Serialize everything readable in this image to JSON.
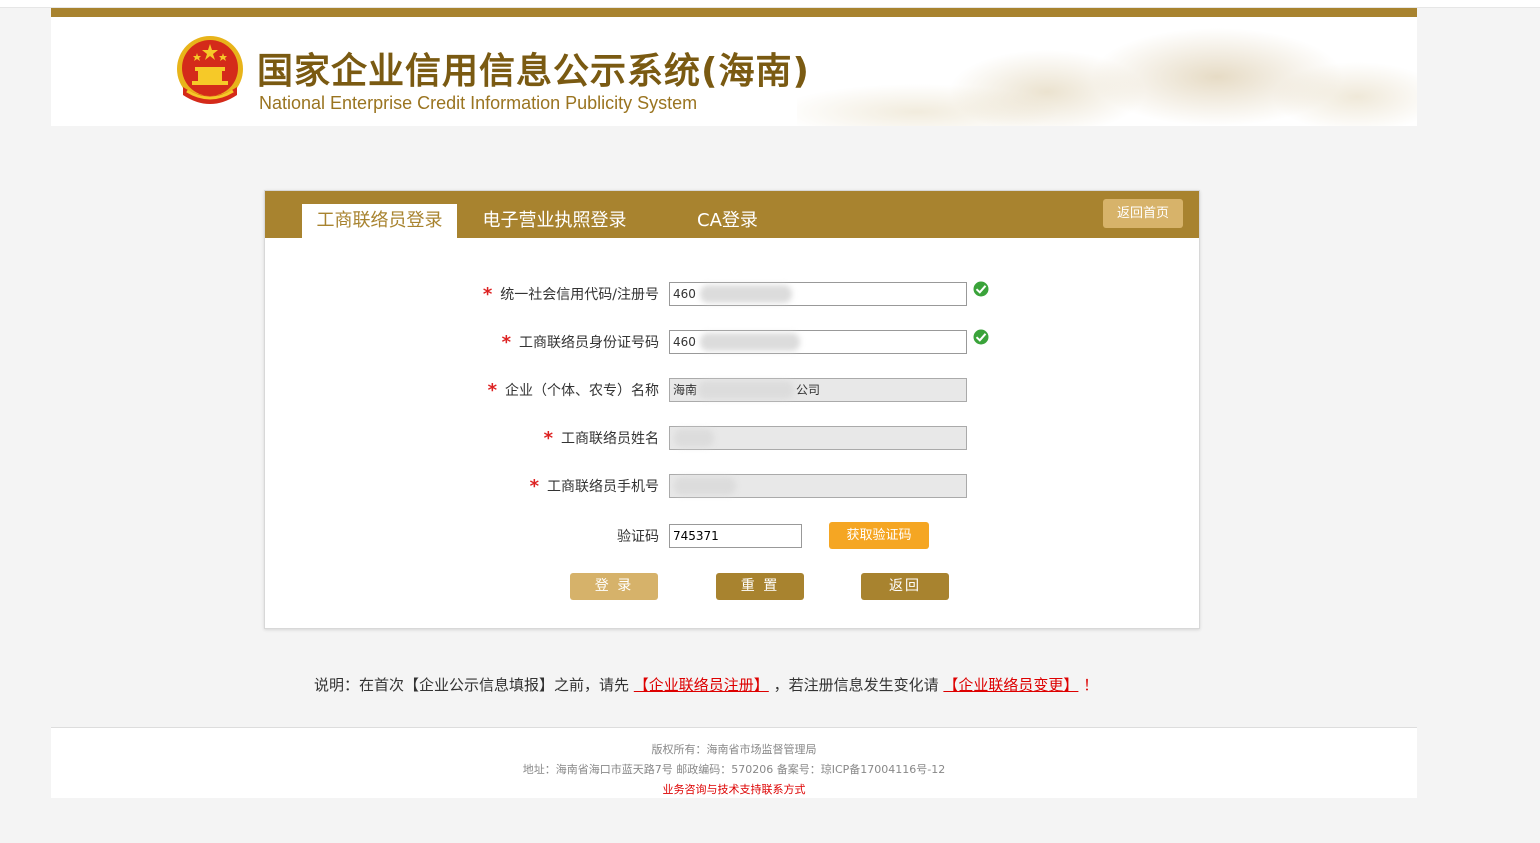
{
  "header": {
    "title_cn": "国家企业信用信息公示系统(海南)",
    "title_en": "National Enterprise Credit Information Publicity System"
  },
  "tabs": [
    {
      "label": "工商联络员登录",
      "active": true
    },
    {
      "label": "电子营业执照登录",
      "active": false
    },
    {
      "label": "CA登录",
      "active": false
    }
  ],
  "home_button": "返回首页",
  "form": {
    "required_mark": "*",
    "credit_code": {
      "label": "统一社会信用代码/注册号",
      "value": "460"
    },
    "id_number": {
      "label": "工商联络员身份证号码",
      "value": "460"
    },
    "company_name": {
      "label": "企业（个体、农专）名称",
      "value_prefix": "海南",
      "value_suffix": "公司"
    },
    "contact_name": {
      "label": "工商联络员姓名",
      "value": ""
    },
    "contact_phone": {
      "label": "工商联络员手机号",
      "value": ""
    },
    "verify_code": {
      "label": "验证码",
      "value": "745371"
    },
    "get_code_button": "获取验证码"
  },
  "actions": {
    "login": "登 录",
    "reset": "重 置",
    "back": "返回"
  },
  "note": {
    "prefix": "说明：在首次【企业公示信息填报】之前，请先",
    "link1": "【企业联络员注册】",
    "middle": "，若注册信息发生变化请",
    "link2": "【企业联络员变更】",
    "suffix": "！"
  },
  "footer": {
    "copyright": "版权所有：海南省市场监督管理局",
    "address": "地址：海南省海口市蓝天路7号 邮政编码：570206 备案号：琼ICP备17004116号-12",
    "support_link": "业务咨询与技术支持联系方式"
  },
  "colors": {
    "brand_gold": "#a8832f",
    "light_gold": "#d6b26a",
    "orange": "#f5a623",
    "required_red": "#dd2222",
    "check_green": "#3aa33a"
  }
}
